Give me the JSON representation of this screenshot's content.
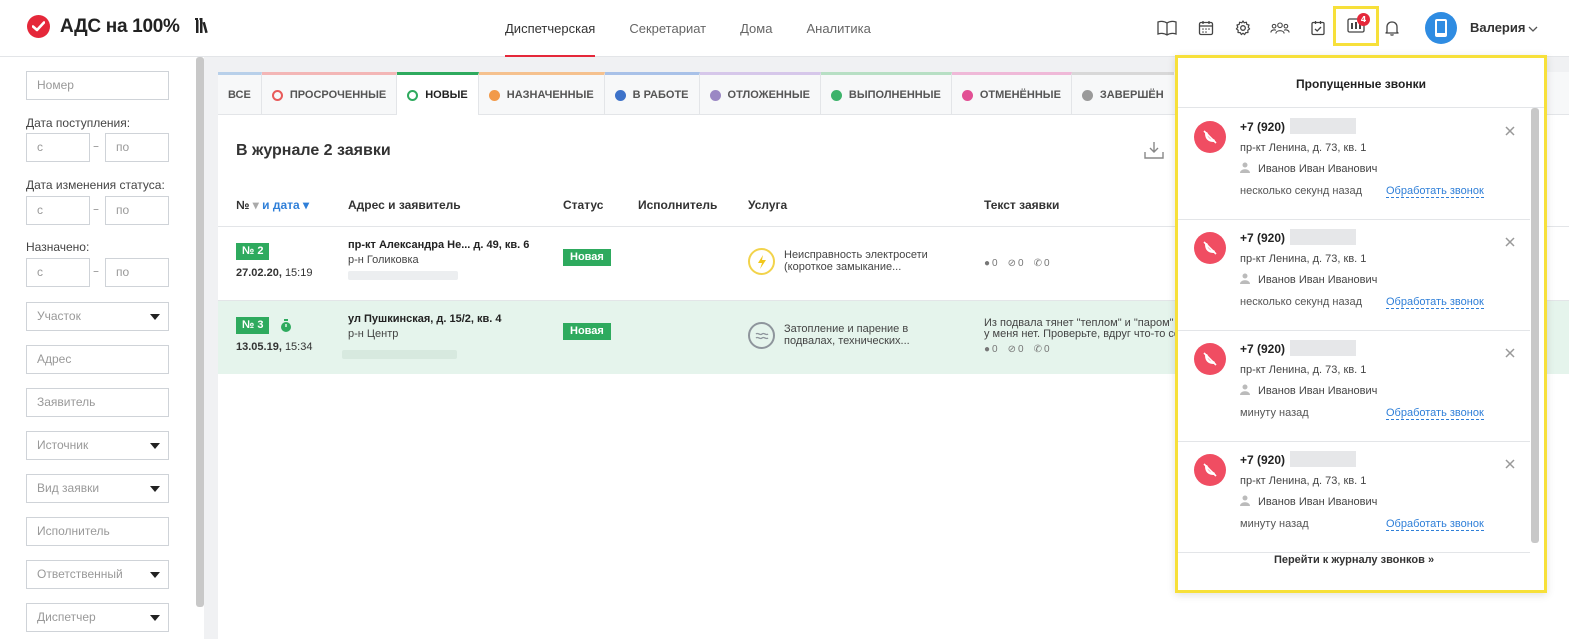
{
  "header": {
    "logo_text": "АДС на 100%",
    "nav": [
      {
        "label": "Диспетчерская",
        "active": true
      },
      {
        "label": "Секретариат",
        "active": false
      },
      {
        "label": "Дома",
        "active": false
      },
      {
        "label": "Аналитика",
        "active": false
      }
    ],
    "icons": [
      "book-icon",
      "calendar-icon",
      "gear-icon",
      "users-icon",
      "tasks-icon",
      "missed-calls-icon",
      "bell-icon"
    ],
    "missed_calls_count": "4",
    "user_name": "Валерия"
  },
  "sidebar": {
    "number_placeholder": "Номер",
    "date_received_label": "Дата поступления:",
    "date_status_label": "Дата изменения статуса:",
    "assigned_label": "Назначено:",
    "from": "с",
    "to": "по",
    "range_dash": "–",
    "area_select": "Участок",
    "address_placeholder": "Адрес",
    "applicant_placeholder": "Заявитель",
    "source_select": "Источник",
    "type_select": "Вид заявки",
    "executor_placeholder": "Исполнитель",
    "responsible_select": "Ответственный",
    "dispatcher_select": "Диспетчер"
  },
  "tabs": [
    {
      "label": "ВСЕ",
      "color": "#b8d0ea"
    },
    {
      "label": "ПРОСРОЧЕННЫЕ",
      "color": "#f3b6b6"
    },
    {
      "label": "НОВЫЕ",
      "color": "#2eaa5e",
      "active": true
    },
    {
      "label": "НАЗНАЧЕННЫЕ",
      "color": "#f5c18e"
    },
    {
      "label": "В РАБОТЕ",
      "color": "#a8c1e8"
    },
    {
      "label": "ОТЛОЖЕННЫЕ",
      "color": "#d6c7ea"
    },
    {
      "label": "ВЫПОЛНЕННЫЕ",
      "color": "#b7dfc4"
    },
    {
      "label": "ОТМЕНЁННЫЕ",
      "color": "#efb9d8"
    },
    {
      "label": "ЗАВЕРШЁН",
      "color": "#d8d8d8"
    }
  ],
  "journal": {
    "title": "В журнале 2 заявки",
    "columns": {
      "num": "№",
      "and_date": "и дата",
      "address": "Адрес и заявитель",
      "status": "Статус",
      "executor": "Исполнитель",
      "service": "Услуга",
      "text": "Текст заявки"
    },
    "rows": [
      {
        "num": "№ 2",
        "date": "27.02.20,",
        "time": "15:19",
        "address": "пр-кт Александра Не... д. 49, кв. 6",
        "district": "р-н Голиковка",
        "status": "Новая",
        "service": "Неисправность электросети (короткое замыкание...",
        "text_line1": "",
        "text_line2": "",
        "comments": "0",
        "attachments": "0",
        "calls": "0"
      },
      {
        "num": "№ 3",
        "date": "13.05.19,",
        "time": "15:34",
        "address": "ул Пушкинская, д. 15/2, кв. 4",
        "district": "р-н Центр",
        "status": "Новая",
        "service": "Затопление и парение в подвалах, технических...",
        "text_line1": "Из подвала тянет \"теплом\" и \"паром\" к",
        "text_line2": "у меня нет. Проверьте, вдруг что-то сел",
        "comments": "0",
        "attachments": "0",
        "calls": "0"
      }
    ]
  },
  "missed_calls": {
    "title": "Пропущенные звонки",
    "footer": "Перейти к журналу звонков »",
    "items": [
      {
        "phone": "+7 (920)",
        "address": "пр-кт Ленина, д. 73, кв. 1",
        "person": "Иванов Иван Иванович",
        "time": "несколько секунд назад",
        "action": "Обработать звонок"
      },
      {
        "phone": "+7 (920)",
        "address": "пр-кт Ленина, д. 73, кв. 1",
        "person": "Иванов Иван Иванович",
        "time": "несколько секунд назад",
        "action": "Обработать звонок"
      },
      {
        "phone": "+7 (920)",
        "address": "пр-кт Ленина, д. 73, кв. 1",
        "person": "Иванов Иван Иванович",
        "time": "минуту назад",
        "action": "Обработать звонок"
      },
      {
        "phone": "+7 (920)",
        "address": "пр-кт Ленина, д. 73, кв. 1",
        "person": "Иванов Иван Иванович",
        "time": "минуту назад",
        "action": "Обработать звонок"
      }
    ]
  }
}
